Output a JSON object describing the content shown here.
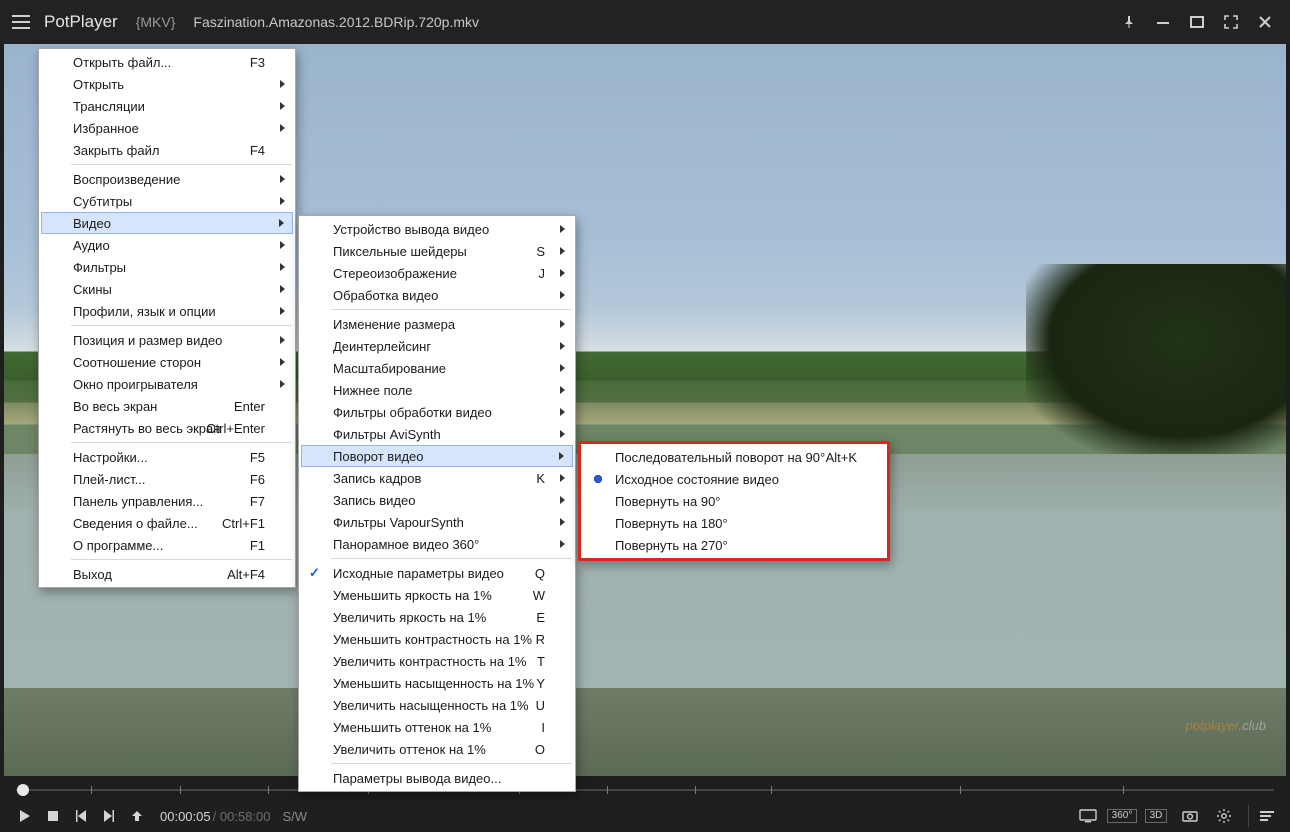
{
  "title": {
    "app": "PotPlayer",
    "format_tag": "{MKV}",
    "filename": "Faszination.Amazonas.2012.BDRip.720p.mkv"
  },
  "watermark": {
    "left": "potplayer",
    "right": ".club"
  },
  "playback": {
    "current": "00:00:05",
    "duration": "/ 00:58:00",
    "mode": "S/W"
  },
  "status_icons": {
    "deg": "360°",
    "three_d": "3D"
  },
  "menu_main": {
    "g1": [
      {
        "label": "Открыть файл...",
        "shortcut": "F3"
      },
      {
        "label": "Открыть",
        "sub": true
      },
      {
        "label": "Трансляции",
        "sub": true
      },
      {
        "label": "Избранное",
        "sub": true
      },
      {
        "label": "Закрыть файл",
        "shortcut": "F4"
      }
    ],
    "g2": [
      {
        "label": "Воспроизведение",
        "sub": true
      },
      {
        "label": "Субтитры",
        "sub": true
      },
      {
        "label": "Видео",
        "sub": true,
        "hl": true
      },
      {
        "label": "Аудио",
        "sub": true
      },
      {
        "label": "Фильтры",
        "sub": true
      },
      {
        "label": "Скины",
        "sub": true
      },
      {
        "label": "Профили, язык и опции",
        "sub": true
      }
    ],
    "g3": [
      {
        "label": "Позиция и размер видео",
        "sub": true
      },
      {
        "label": "Соотношение сторон",
        "sub": true
      },
      {
        "label": "Окно проигрывателя",
        "sub": true
      },
      {
        "label": "Во весь экран",
        "shortcut": "Enter"
      },
      {
        "label": "Растянуть во весь экран",
        "shortcut": "Ctrl+Enter"
      }
    ],
    "g4": [
      {
        "label": "Настройки...",
        "shortcut": "F5"
      },
      {
        "label": "Плей-лист...",
        "shortcut": "F6"
      },
      {
        "label": "Панель управления...",
        "shortcut": "F7"
      },
      {
        "label": "Сведения о файле...",
        "shortcut": "Ctrl+F1"
      },
      {
        "label": "О программе...",
        "shortcut": "F1"
      }
    ],
    "g5": [
      {
        "label": "Выход",
        "shortcut": "Alt+F4"
      }
    ]
  },
  "menu_video": {
    "g1": [
      {
        "label": "Устройство вывода видео",
        "sub": true
      },
      {
        "label": "Пиксельные шейдеры",
        "shortcut": "S",
        "sub": true
      },
      {
        "label": "Стереоизображение",
        "shortcut": "J",
        "sub": true
      },
      {
        "label": "Обработка видео",
        "sub": true
      }
    ],
    "g2": [
      {
        "label": "Изменение размера",
        "sub": true
      },
      {
        "label": "Деинтерлейсинг",
        "sub": true
      },
      {
        "label": "Масштабирование",
        "sub": true
      },
      {
        "label": "Нижнее поле",
        "sub": true
      },
      {
        "label": "Фильтры обработки видео",
        "sub": true
      },
      {
        "label": "Фильтры AviSynth",
        "sub": true
      },
      {
        "label": "Поворот видео",
        "sub": true,
        "hl": true
      },
      {
        "label": "Запись кадров",
        "shortcut": "K",
        "sub": true
      },
      {
        "label": "Запись видео",
        "sub": true
      },
      {
        "label": "Фильтры VapourSynth",
        "sub": true
      },
      {
        "label": "Панорамное видео 360°",
        "sub": true
      }
    ],
    "g3": [
      {
        "label": "Исходные параметры видео",
        "shortcut": "Q",
        "chk": true
      },
      {
        "label": "Уменьшить яркость на 1%",
        "shortcut": "W"
      },
      {
        "label": "Увеличить яркость на 1%",
        "shortcut": "E"
      },
      {
        "label": "Уменьшить контрастность на 1%",
        "shortcut": "R"
      },
      {
        "label": "Увеличить контрастность на 1%",
        "shortcut": "T"
      },
      {
        "label": "Уменьшить насыщенность на 1%",
        "shortcut": "Y"
      },
      {
        "label": "Увеличить насыщенность на 1%",
        "shortcut": "U"
      },
      {
        "label": "Уменьшить оттенок на 1%",
        "shortcut": "I"
      },
      {
        "label": "Увеличить оттенок на 1%",
        "shortcut": "O"
      }
    ],
    "g4": [
      {
        "label": "Параметры вывода видео..."
      }
    ]
  },
  "menu_rotate": [
    {
      "label": "Последовательный поворот на 90°",
      "shortcut": "Alt+K"
    },
    {
      "label": "Исходное состояние видео",
      "radio": true
    },
    {
      "label": "Повернуть на 90°"
    },
    {
      "label": "Повернуть на 180°"
    },
    {
      "label": "Повернуть на 270°"
    }
  ]
}
